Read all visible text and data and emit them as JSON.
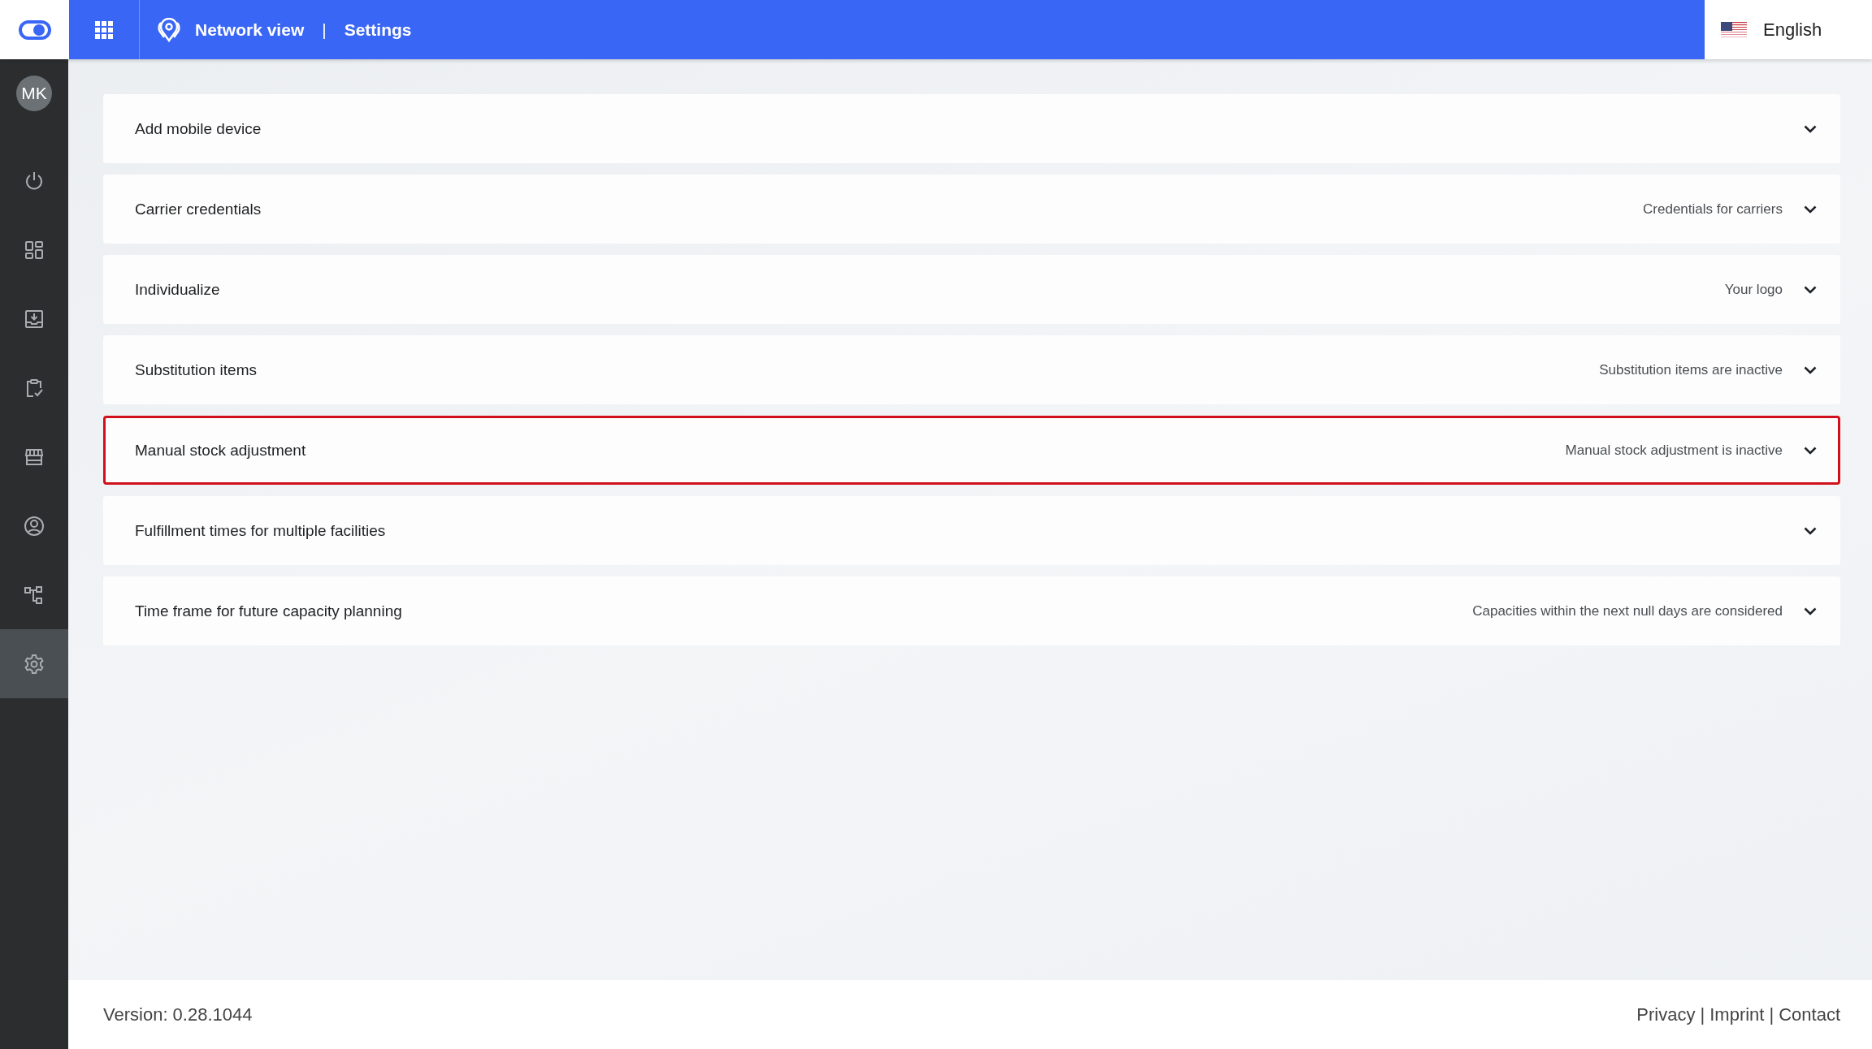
{
  "header": {
    "app_title": "Network view",
    "separator": "|",
    "page_title": "Settings",
    "language": "English"
  },
  "sidebar": {
    "avatar": "MK",
    "items": [
      {
        "kind": "power",
        "selected": false
      },
      {
        "kind": "dashboard",
        "selected": false
      },
      {
        "kind": "inbox",
        "selected": false
      },
      {
        "kind": "clipboard",
        "selected": false
      },
      {
        "kind": "store",
        "selected": false
      },
      {
        "kind": "user",
        "selected": false
      },
      {
        "kind": "hierarchy",
        "selected": false
      },
      {
        "kind": "settings",
        "selected": true
      }
    ]
  },
  "settings_panels": [
    {
      "title": "Add mobile device",
      "highlighted": false
    },
    {
      "title": "Carrier credentials",
      "summary": "Credentials for carriers",
      "highlighted": false
    },
    {
      "title": "Individualize",
      "summary": "Your logo",
      "highlighted": false
    },
    {
      "title": "Substitution items",
      "summary": "Substitution items are inactive",
      "highlighted": false
    },
    {
      "title": "Manual stock adjustment",
      "summary": "Manual stock adjustment is inactive",
      "highlighted": true
    },
    {
      "title": "Fulfillment times for multiple facilities",
      "highlighted": false
    },
    {
      "title": "Time frame for future capacity planning",
      "summary": "Capacities within the next null days are considered",
      "highlighted": false
    }
  ],
  "footer": {
    "version": "Version: 0.28.1044",
    "links": [
      "Privacy",
      "Imprint",
      "Contact"
    ],
    "separator": "|"
  }
}
